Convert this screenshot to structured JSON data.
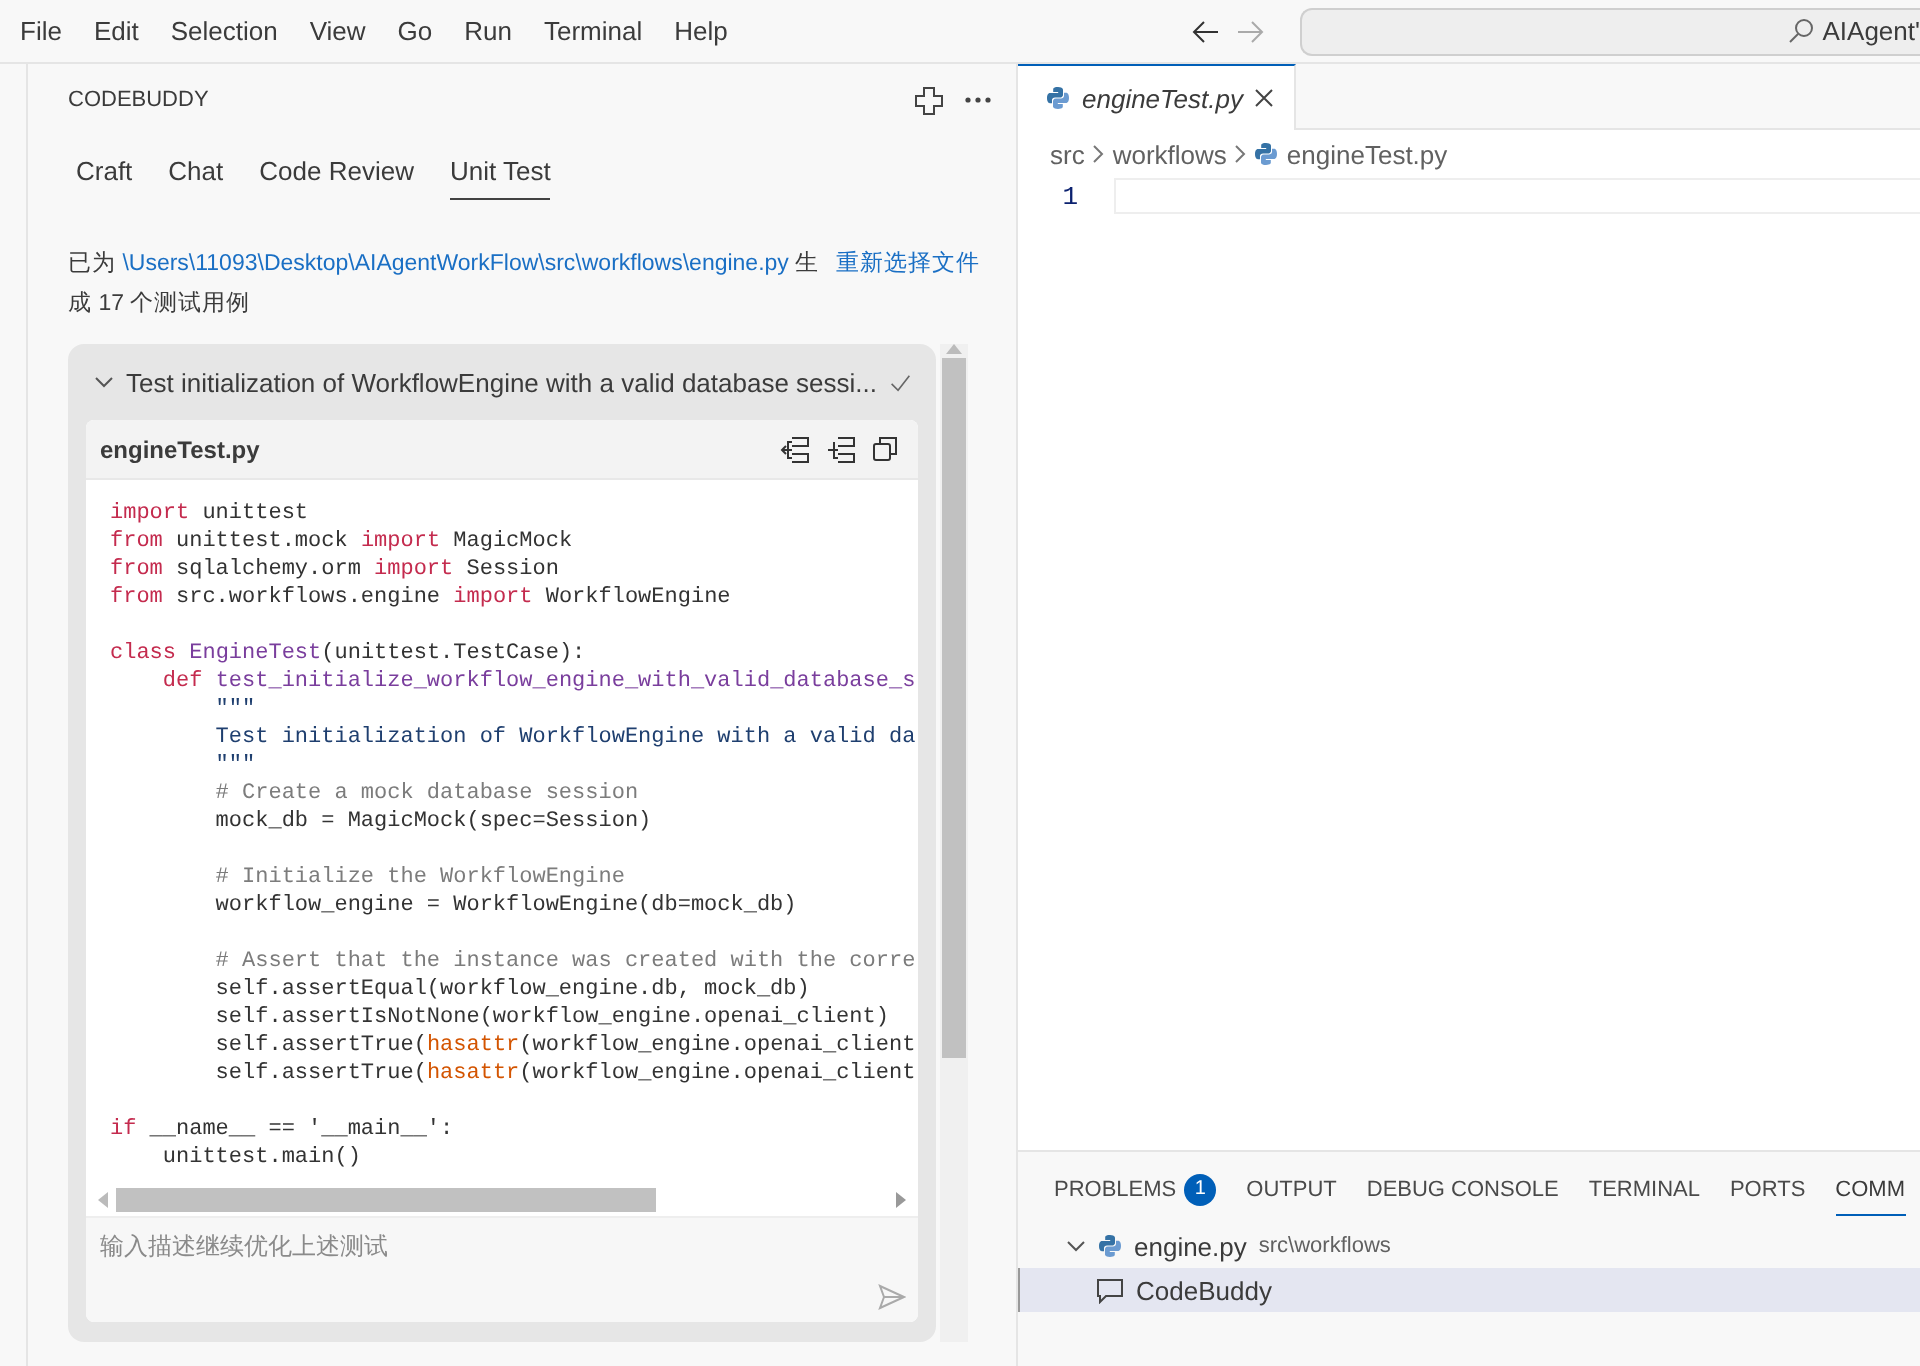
{
  "menu": [
    "File",
    "Edit",
    "Selection",
    "View",
    "Go",
    "Run",
    "Terminal",
    "Help"
  ],
  "search": {
    "value": "AIAgent'"
  },
  "codebuddy": {
    "title": "CODEBUDDY",
    "tabs": [
      {
        "label": "Craft",
        "selected": false
      },
      {
        "label": "Chat",
        "selected": false
      },
      {
        "label": "Code Review",
        "selected": false
      },
      {
        "label": "Unit Test",
        "selected": true
      }
    ],
    "message": {
      "prefix": "已为",
      "path": "\\Users\\11093\\Desktop\\AIAgentWorkFlow\\src\\workflows\\engine.py",
      "suffix": "生成 17 个测试用例"
    },
    "reselect": "重新选择文件",
    "test_case": {
      "title": "Test initialization of WorkflowEngine with a valid database sessi...",
      "expanded": true,
      "passed": true,
      "file": "engineTest.py",
      "lines": [
        {
          "kind": "code",
          "tokens": [
            {
              "text": "import",
              "kind": "kw"
            },
            {
              "text": " unittest",
              "kind": "plain"
            }
          ]
        },
        {
          "kind": "code",
          "tokens": [
            {
              "text": "from",
              "kind": "kw"
            },
            {
              "text": " unittest.mock ",
              "kind": "plain"
            },
            {
              "text": "import",
              "kind": "kw"
            },
            {
              "text": " MagicMock",
              "kind": "plain"
            }
          ]
        },
        {
          "kind": "code",
          "tokens": [
            {
              "text": "from",
              "kind": "kw"
            },
            {
              "text": " sqlalchemy.orm ",
              "kind": "plain"
            },
            {
              "text": "import",
              "kind": "kw"
            },
            {
              "text": " Session",
              "kind": "plain"
            }
          ]
        },
        {
          "kind": "code",
          "tokens": [
            {
              "text": "from",
              "kind": "kw"
            },
            {
              "text": " src.workflows.engine ",
              "kind": "plain"
            },
            {
              "text": "import",
              "kind": "kw"
            },
            {
              "text": " WorkflowEngine",
              "kind": "plain"
            }
          ]
        },
        {
          "kind": "blank"
        },
        {
          "kind": "code",
          "tokens": [
            {
              "text": "class",
              "kind": "kw"
            },
            {
              "text": " EngineTest",
              "kind": "name"
            },
            {
              "text": "(unittest.TestCase):",
              "kind": "plain"
            }
          ]
        },
        {
          "kind": "code",
          "tokens": [
            {
              "text": "    def",
              "kind": "kw"
            },
            {
              "text": " test_initialize_workflow_engine_with_valid_database_s",
              "kind": "name"
            }
          ]
        },
        {
          "kind": "code",
          "tokens": [
            {
              "text": "        \"\"\"",
              "kind": "doc"
            }
          ]
        },
        {
          "kind": "code",
          "tokens": [
            {
              "text": "        Test initialization of WorkflowEngine with a valid da",
              "kind": "doc"
            }
          ]
        },
        {
          "kind": "code",
          "tokens": [
            {
              "text": "        \"\"\"",
              "kind": "doc"
            }
          ]
        },
        {
          "kind": "code",
          "tokens": [
            {
              "text": "        # Create a mock database session",
              "kind": "comment"
            }
          ]
        },
        {
          "kind": "code",
          "tokens": [
            {
              "text": "        mock_db = MagicMock(spec=Session)",
              "kind": "plain"
            }
          ]
        },
        {
          "kind": "blank"
        },
        {
          "kind": "code",
          "tokens": [
            {
              "text": "        # Initialize the WorkflowEngine",
              "kind": "comment"
            }
          ]
        },
        {
          "kind": "code",
          "tokens": [
            {
              "text": "        workflow_engine = WorkflowEngine(db=mock_db)",
              "kind": "plain"
            }
          ]
        },
        {
          "kind": "blank"
        },
        {
          "kind": "code",
          "tokens": [
            {
              "text": "        # Assert that the instance was created with the corre",
              "kind": "comment"
            }
          ]
        },
        {
          "kind": "code",
          "tokens": [
            {
              "text": "        self.assertEqual(workflow_engine.db, mock_db)",
              "kind": "plain"
            }
          ]
        },
        {
          "kind": "code",
          "tokens": [
            {
              "text": "        self.assertIsNotNone(workflow_engine.openai_client)",
              "kind": "plain"
            }
          ]
        },
        {
          "kind": "code",
          "tokens": [
            {
              "text": "        self.assertTrue(",
              "kind": "plain"
            },
            {
              "text": "hasattr",
              "kind": "builtin"
            },
            {
              "text": "(workflow_engine.openai_client",
              "kind": "plain"
            }
          ]
        },
        {
          "kind": "code",
          "tokens": [
            {
              "text": "        self.assertTrue(",
              "kind": "plain"
            },
            {
              "text": "hasattr",
              "kind": "builtin"
            },
            {
              "text": "(workflow_engine.openai_client",
              "kind": "plain"
            }
          ]
        },
        {
          "kind": "blank"
        },
        {
          "kind": "code",
          "tokens": [
            {
              "text": "if",
              "kind": "kw"
            },
            {
              "text": " __name__ == '__main__':",
              "kind": "plain"
            }
          ]
        },
        {
          "kind": "code",
          "tokens": [
            {
              "text": "    unittest.main()",
              "kind": "plain"
            }
          ]
        }
      ],
      "input": {
        "placeholder": "输入描述继续优化上述测试"
      }
    }
  },
  "editor": {
    "tab": {
      "label": "engineTest.py",
      "selected": true
    },
    "breadcrumb": [
      "src",
      "workflows",
      "engineTest.py"
    ],
    "line_numbers": [
      "1"
    ]
  },
  "panel": {
    "tabs": [
      {
        "label": "PROBLEMS",
        "badge": "1",
        "selected": false
      },
      {
        "label": "OUTPUT",
        "selected": false
      },
      {
        "label": "DEBUG CONSOLE",
        "selected": false
      },
      {
        "label": "TERMINAL",
        "selected": false
      },
      {
        "label": "PORTS",
        "selected": false
      },
      {
        "label": "COMM",
        "selected": true
      }
    ],
    "problems": [
      {
        "file": "engine.py",
        "path": "src\\workflows",
        "expanded": true,
        "children": [
          {
            "source": "CodeBuddy",
            "selected": true
          }
        ]
      }
    ]
  }
}
